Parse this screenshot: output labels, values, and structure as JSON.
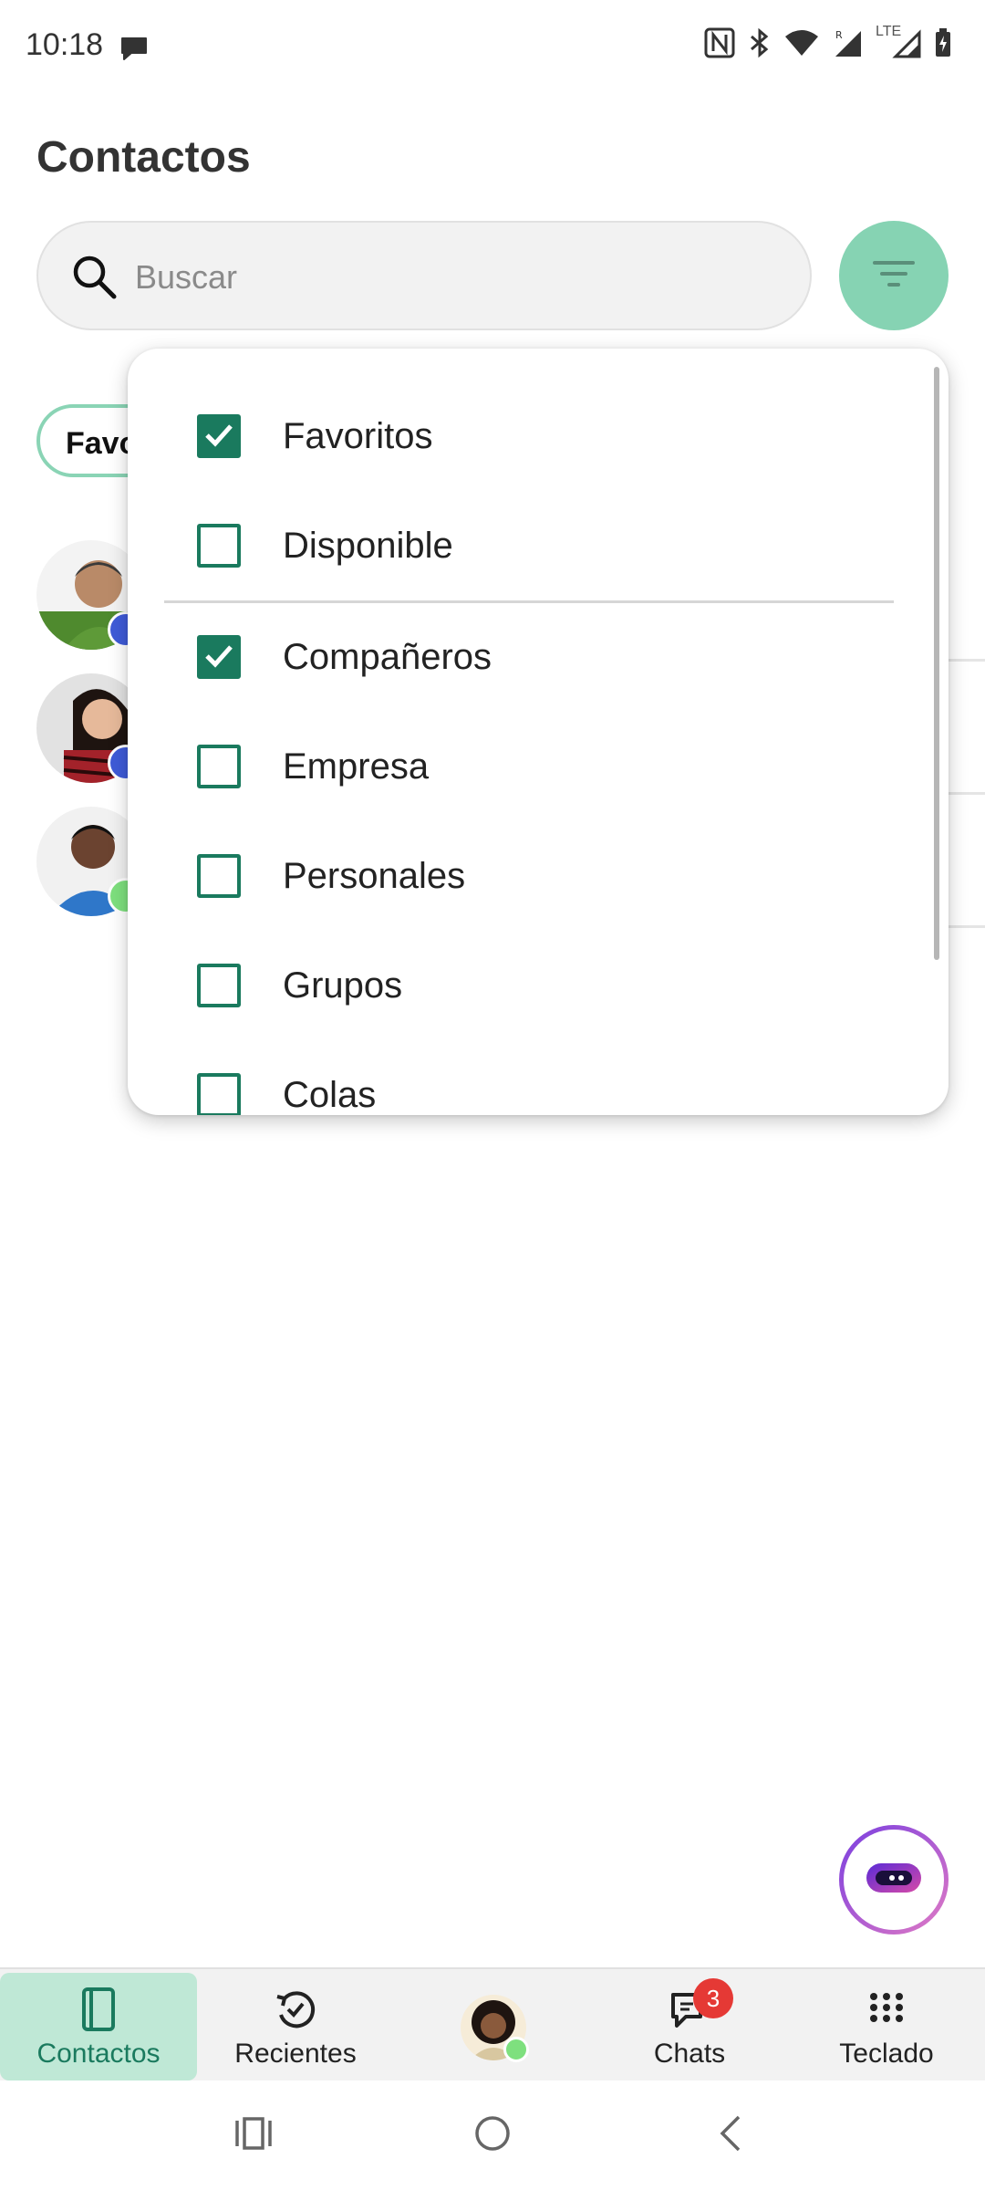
{
  "status_bar": {
    "time": "10:18",
    "icons": [
      "chat-bubble-icon",
      "nfc-icon",
      "bluetooth-icon",
      "wifi-icon",
      "signal-r-icon",
      "signal-lte-icon",
      "battery-charging-icon"
    ],
    "network_label": "LTE"
  },
  "page": {
    "title": "Contactos"
  },
  "search": {
    "placeholder": "Buscar",
    "value": ""
  },
  "filter_button": {
    "icon": "filter-icon",
    "accent": "#86d3b3"
  },
  "chip": {
    "label": "Favo"
  },
  "contacts": [
    {
      "presence_color": "#3f5bd8"
    },
    {
      "presence_color": "#3f5bd8"
    },
    {
      "presence_color": "#7ee07e"
    }
  ],
  "filter_menu": {
    "items": [
      {
        "label": "Favoritos",
        "checked": true
      },
      {
        "label": "Disponible",
        "checked": false
      },
      {
        "label": "Compañeros",
        "checked": true
      },
      {
        "label": "Empresa",
        "checked": false
      },
      {
        "label": "Personales",
        "checked": false
      },
      {
        "label": "Grupos",
        "checked": false
      },
      {
        "label": "Colas",
        "checked": false
      }
    ],
    "accent": "#1a7a5e"
  },
  "bottom_nav": {
    "items": [
      {
        "label": "Contactos",
        "icon": "contacts-icon",
        "active": true
      },
      {
        "label": "Recientes",
        "icon": "recents-icon",
        "active": false
      },
      {
        "label": "",
        "icon": "profile-avatar",
        "active": false
      },
      {
        "label": "Chats",
        "icon": "chat-icon",
        "active": false,
        "badge": "3"
      },
      {
        "label": "Teclado",
        "icon": "dialpad-icon",
        "active": false
      }
    ]
  },
  "system_nav": {
    "icons": [
      "recent-apps-icon",
      "home-icon",
      "back-icon"
    ]
  }
}
